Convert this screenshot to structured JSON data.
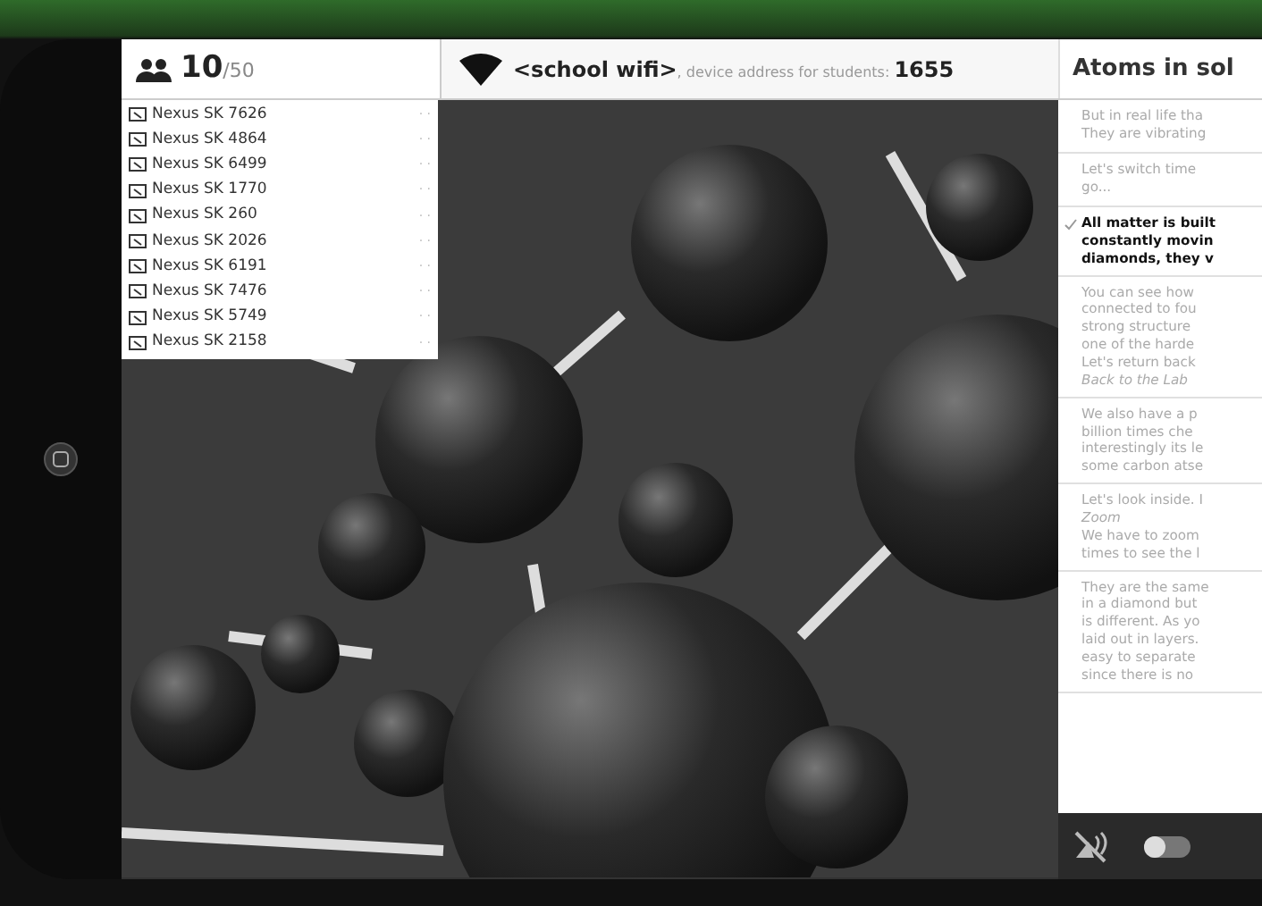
{
  "header": {
    "users_count": "10",
    "users_max": "/50",
    "network_name": "<school wifi>",
    "network_note": ", device address for students: ",
    "address": "1655",
    "panel_title": "Atoms in sol"
  },
  "devices": [
    {
      "name": "Nexus SK 7626",
      "status": "· ·"
    },
    {
      "name": "Nexus SK 4864",
      "status": "· ·"
    },
    {
      "name": "Nexus SK 6499",
      "status": "· ·"
    },
    {
      "name": "Nexus SK 1770",
      "status": "· ·"
    },
    {
      "name": "Nexus SK 260",
      "status": "· ·"
    },
    {
      "name": "Nexus SK 2026",
      "status": "· ·"
    },
    {
      "name": "Nexus SK 6191",
      "status": "· ·"
    },
    {
      "name": "Nexus SK 7476",
      "status": "· ·"
    },
    {
      "name": "Nexus SK 5749",
      "status": "· ·"
    },
    {
      "name": "Nexus SK 2158",
      "status": "· ·"
    }
  ],
  "steps": [
    {
      "selected": false,
      "lines": [
        "But in real life tha",
        "They are vibrating"
      ]
    },
    {
      "selected": false,
      "lines": [
        "Let's switch time",
        "go..."
      ]
    },
    {
      "selected": true,
      "lines": [
        "All matter is built",
        "constantly movin",
        "diamonds, they v"
      ]
    },
    {
      "selected": false,
      "lines": [
        "You can see how",
        "connected to fou",
        "strong structure",
        "one of the harde",
        "Let's return back",
        "*Back to the Lab*"
      ]
    },
    {
      "selected": false,
      "lines": [
        "We also have a p",
        "billion times che",
        "interestingly its le",
        "some carbon atse"
      ]
    },
    {
      "selected": false,
      "lines": [
        "Let's look inside. I",
        "*Zoom*",
        "We have to zoom",
        "times to see the l"
      ]
    },
    {
      "selected": false,
      "lines": [
        "They are the same",
        "in a diamond but",
        "is different. As yo",
        "laid out in layers.",
        "easy to separate",
        "since there is no"
      ]
    }
  ],
  "controls": {
    "sound_muted": true,
    "toggle_on": false
  }
}
